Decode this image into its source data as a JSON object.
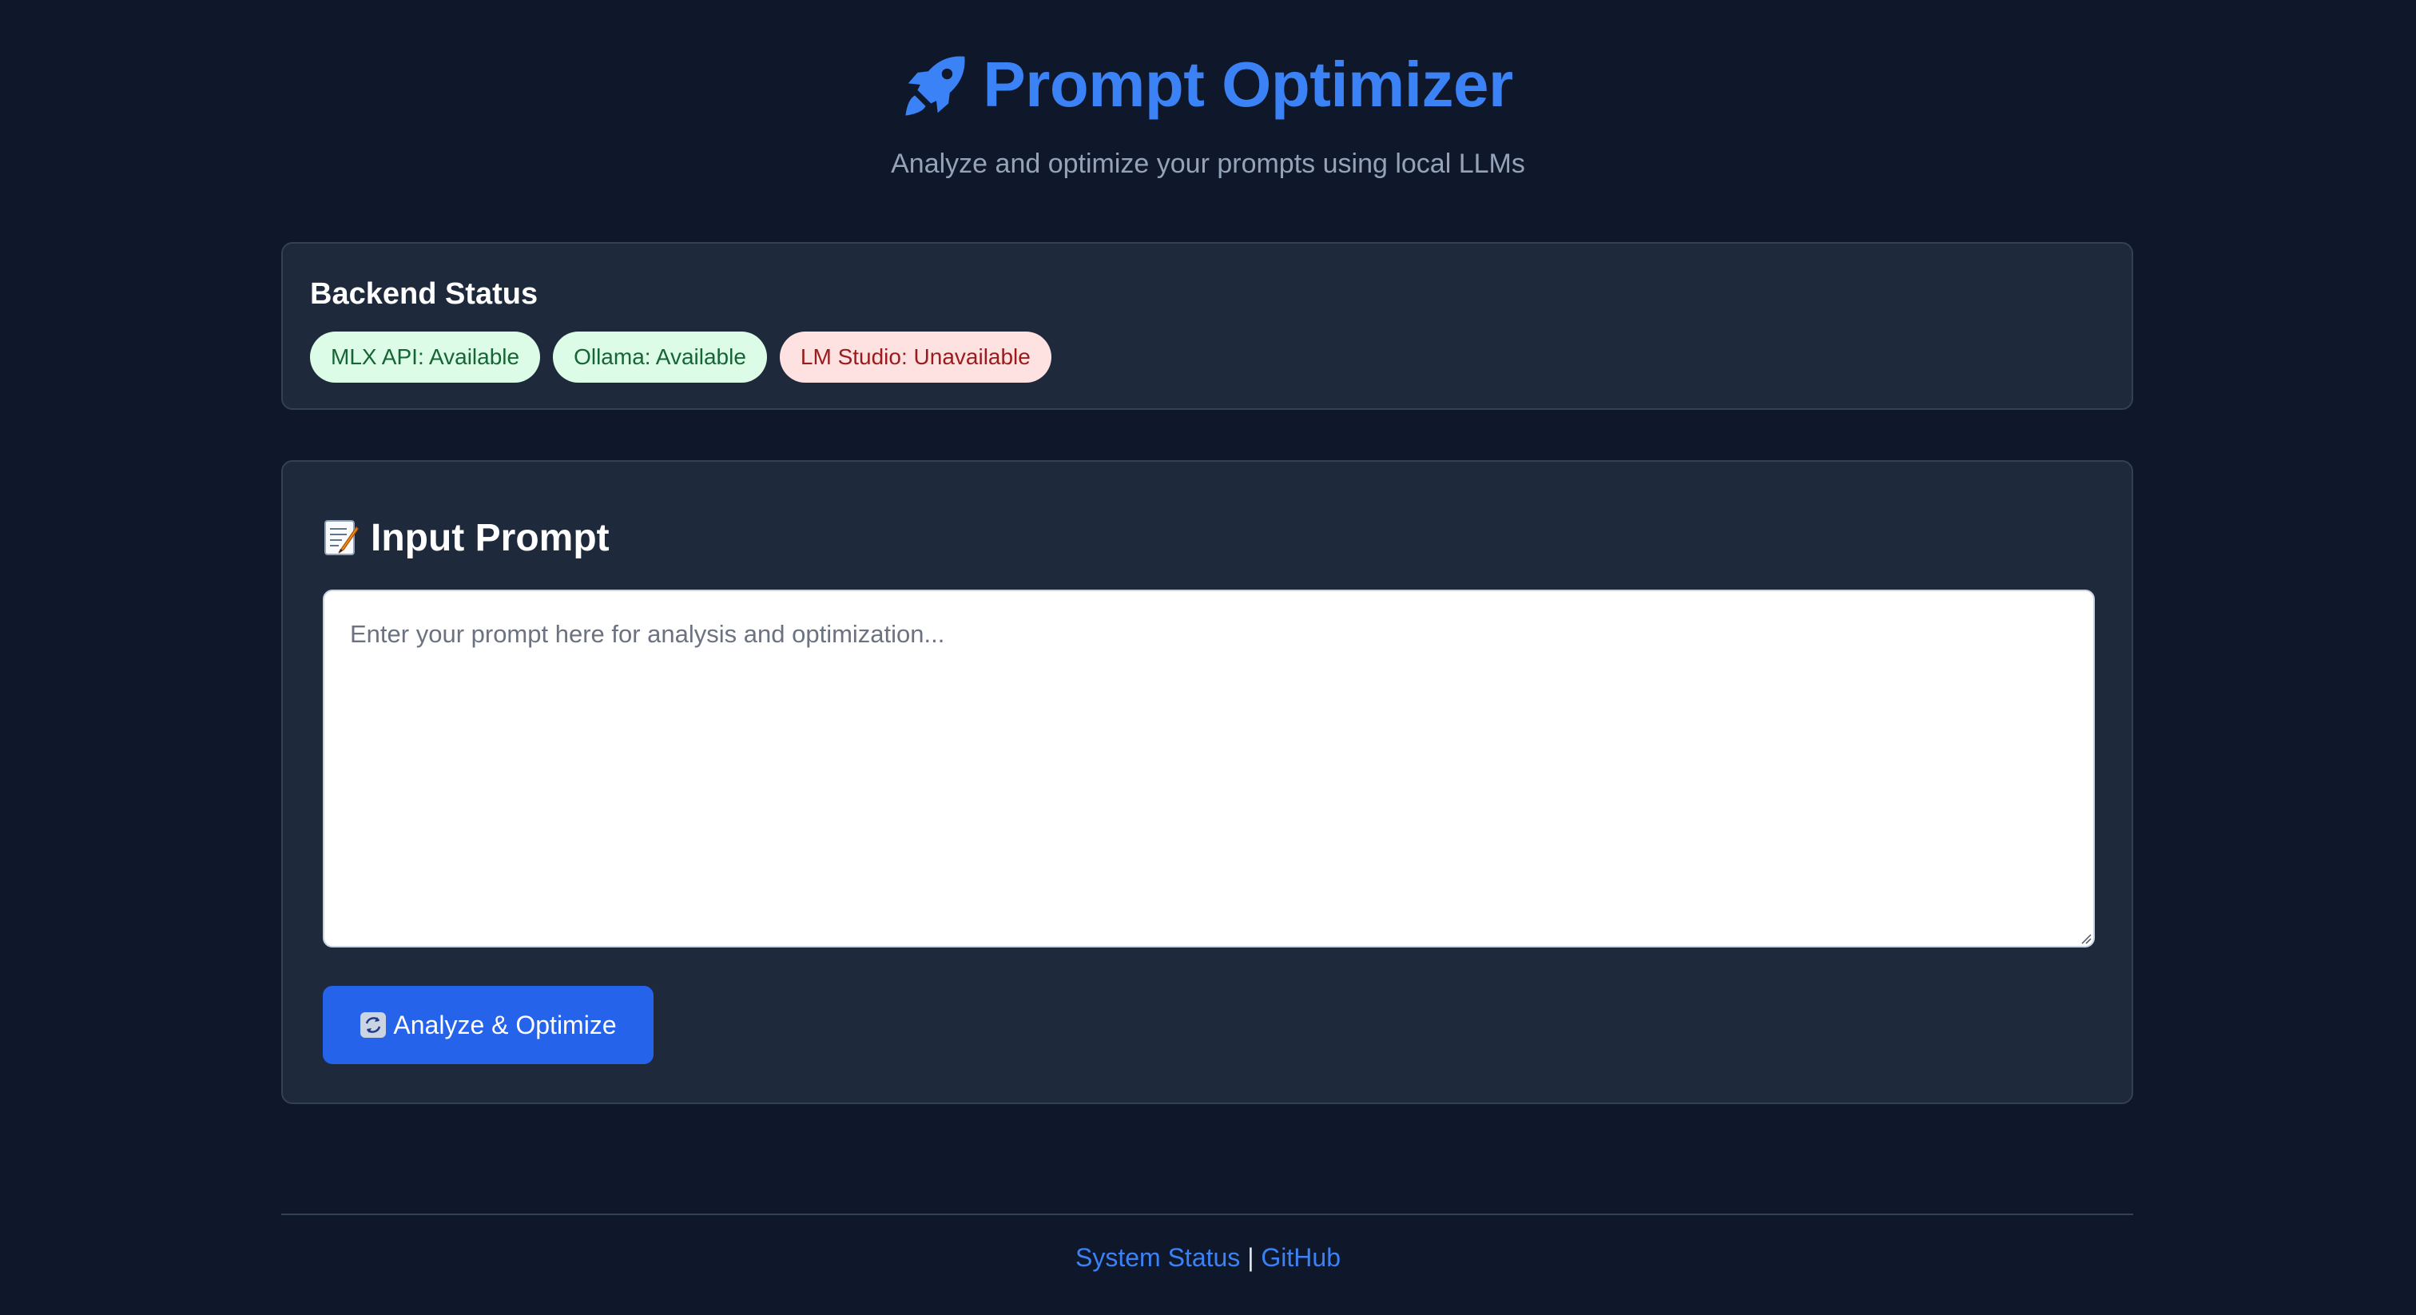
{
  "header": {
    "icon": "rocket-icon",
    "title": "Prompt Optimizer",
    "subtitle": "Analyze and optimize your prompts using local LLMs"
  },
  "backend_status": {
    "title": "Backend Status",
    "badges": [
      {
        "label": "MLX API: Available",
        "state": "available"
      },
      {
        "label": "Ollama: Available",
        "state": "available"
      },
      {
        "label": "LM Studio: Unavailable",
        "state": "unavailable"
      }
    ]
  },
  "input_prompt": {
    "icon": "memo-icon",
    "title": "Input Prompt",
    "value": "",
    "placeholder": "Enter your prompt here for analysis and optimization...",
    "button_icon": "cycle-arrows-icon",
    "button_label": "Analyze & Optimize"
  },
  "footer": {
    "link_status": "System Status",
    "separator": "|",
    "link_github": "GitHub"
  },
  "colors": {
    "background": "#0f172a",
    "card": "#1e293b",
    "accent": "#3b82f6",
    "button": "#2563eb",
    "available_bg": "#dcfce7",
    "available_text": "#166534",
    "unavailable_bg": "#fee2e2",
    "unavailable_text": "#991b1b"
  }
}
